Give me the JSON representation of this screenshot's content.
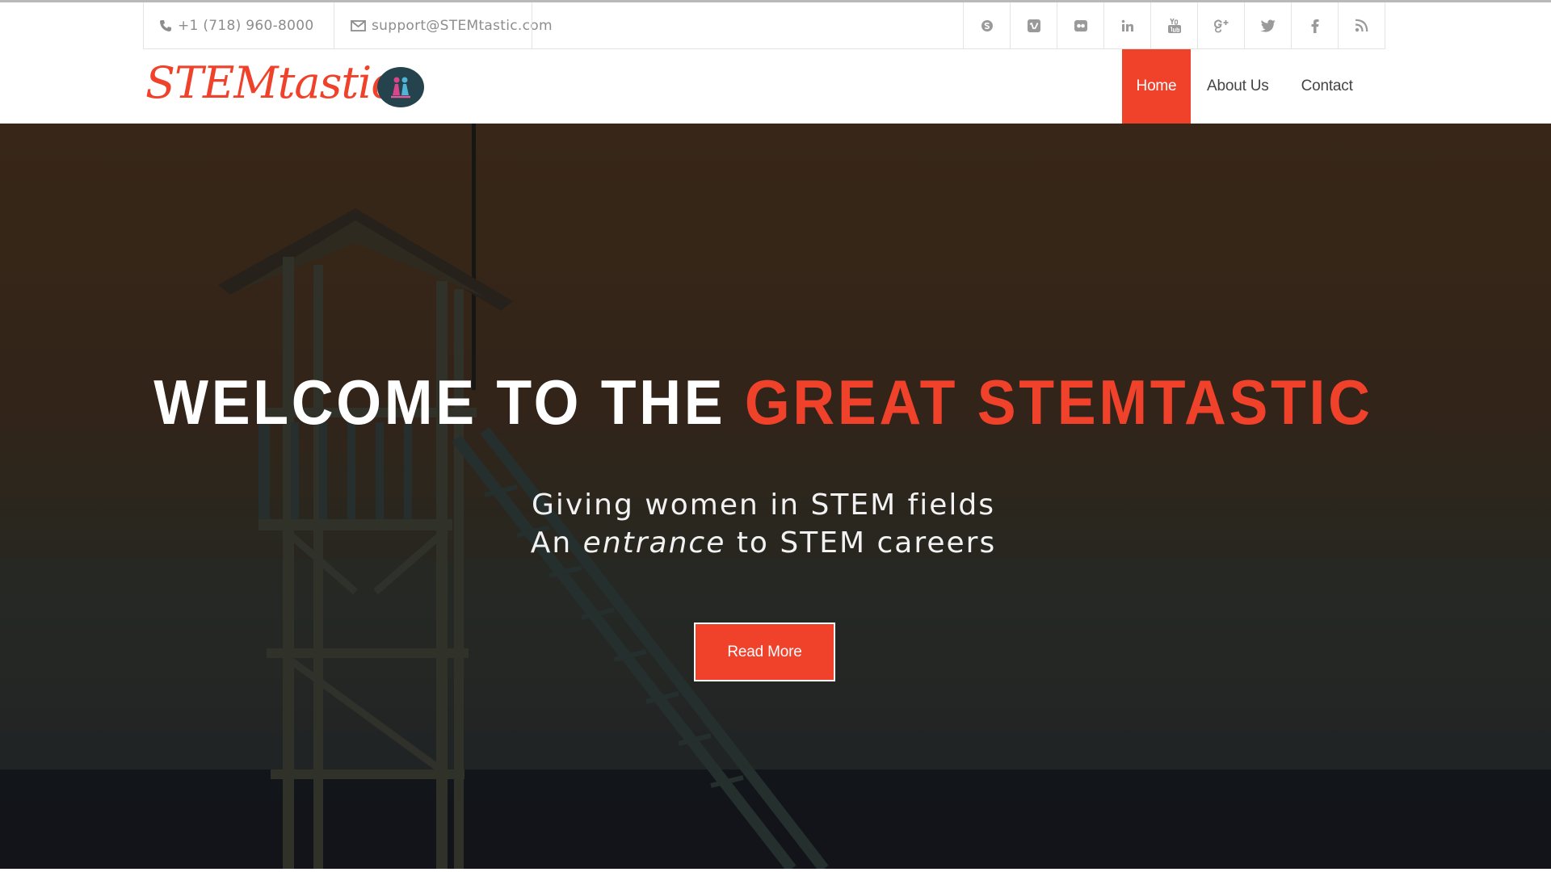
{
  "topbar": {
    "phone": "+1 (718) 960-8000",
    "email": "support@STEMtastic.com",
    "social_icons": [
      "skype-icon",
      "vimeo-icon",
      "flickr-icon",
      "linkedin-icon",
      "youtube-icon",
      "google-plus-icon",
      "twitter-icon",
      "facebook-icon",
      "rss-icon"
    ]
  },
  "header": {
    "logo_text": "STEMtastic",
    "nav": [
      {
        "label": "Home",
        "active": true
      },
      {
        "label": "About Us",
        "active": false
      },
      {
        "label": "Contact",
        "active": false
      }
    ]
  },
  "hero": {
    "title_white": "WELCOME TO THE ",
    "title_accent": "GREAT STEMTASTIC",
    "sub_line1": "Giving women in STEM fields",
    "sub_line2_pre": "An ",
    "sub_line2_em": "entrance",
    "sub_line2_post": " to STEM careers",
    "button_label": "Read More"
  },
  "colors": {
    "accent": "#f0412b",
    "text_muted": "#8d8d8d"
  }
}
